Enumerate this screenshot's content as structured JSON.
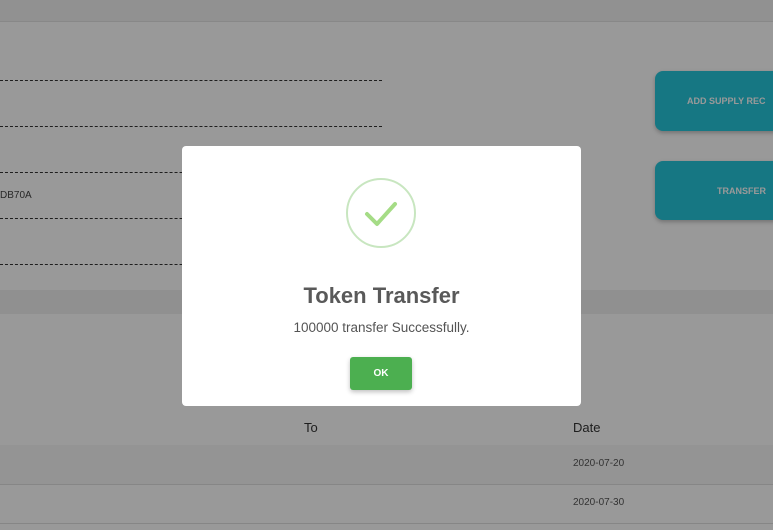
{
  "background": {
    "field_value": "DB70A",
    "buttons": {
      "add_supply": "ADD SUPPLY REC",
      "transfer": "TRANSFER"
    },
    "table": {
      "headers": {
        "to": "To",
        "date": "Date"
      },
      "rows": [
        {
          "date": "2020-07-20"
        },
        {
          "date": "2020-07-30"
        }
      ]
    }
  },
  "modal": {
    "icon": "check-icon",
    "title": "Token Transfer",
    "message": "100000 transfer Successfully.",
    "ok_label": "OK"
  },
  "colors": {
    "accent_teal": "#26c6da",
    "success_green": "#4caf50",
    "check_green": "#a5dc86"
  }
}
